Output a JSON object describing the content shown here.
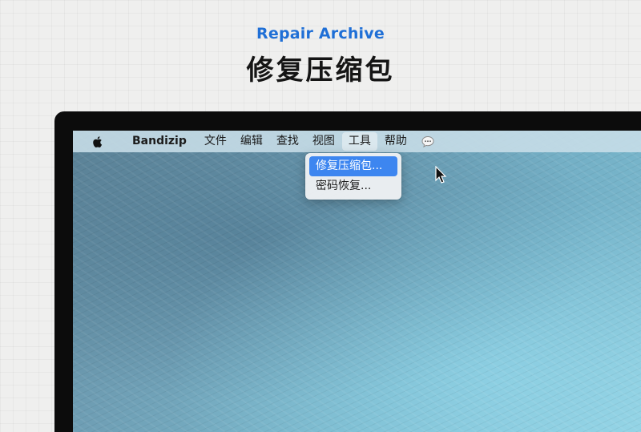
{
  "header": {
    "subtitle": "Repair Archive",
    "title": "修复压缩包"
  },
  "menubar": {
    "apple_icon": "apple-logo-icon",
    "app_name": "Bandizip",
    "items": [
      "文件",
      "编辑",
      "查找",
      "视图",
      "工具",
      "帮助"
    ],
    "active_item": "工具",
    "extra_icon": "chat-bubble-icon"
  },
  "dropdown": {
    "items": [
      {
        "label": "修复压缩包...",
        "highlighted": true
      },
      {
        "label": "密码恢复...",
        "highlighted": false
      }
    ],
    "highlight_color": "#3d86f0"
  },
  "colors": {
    "subtitle": "#1f6fd6",
    "title": "#151515",
    "monitor_bezel": "#0c0c0c"
  }
}
